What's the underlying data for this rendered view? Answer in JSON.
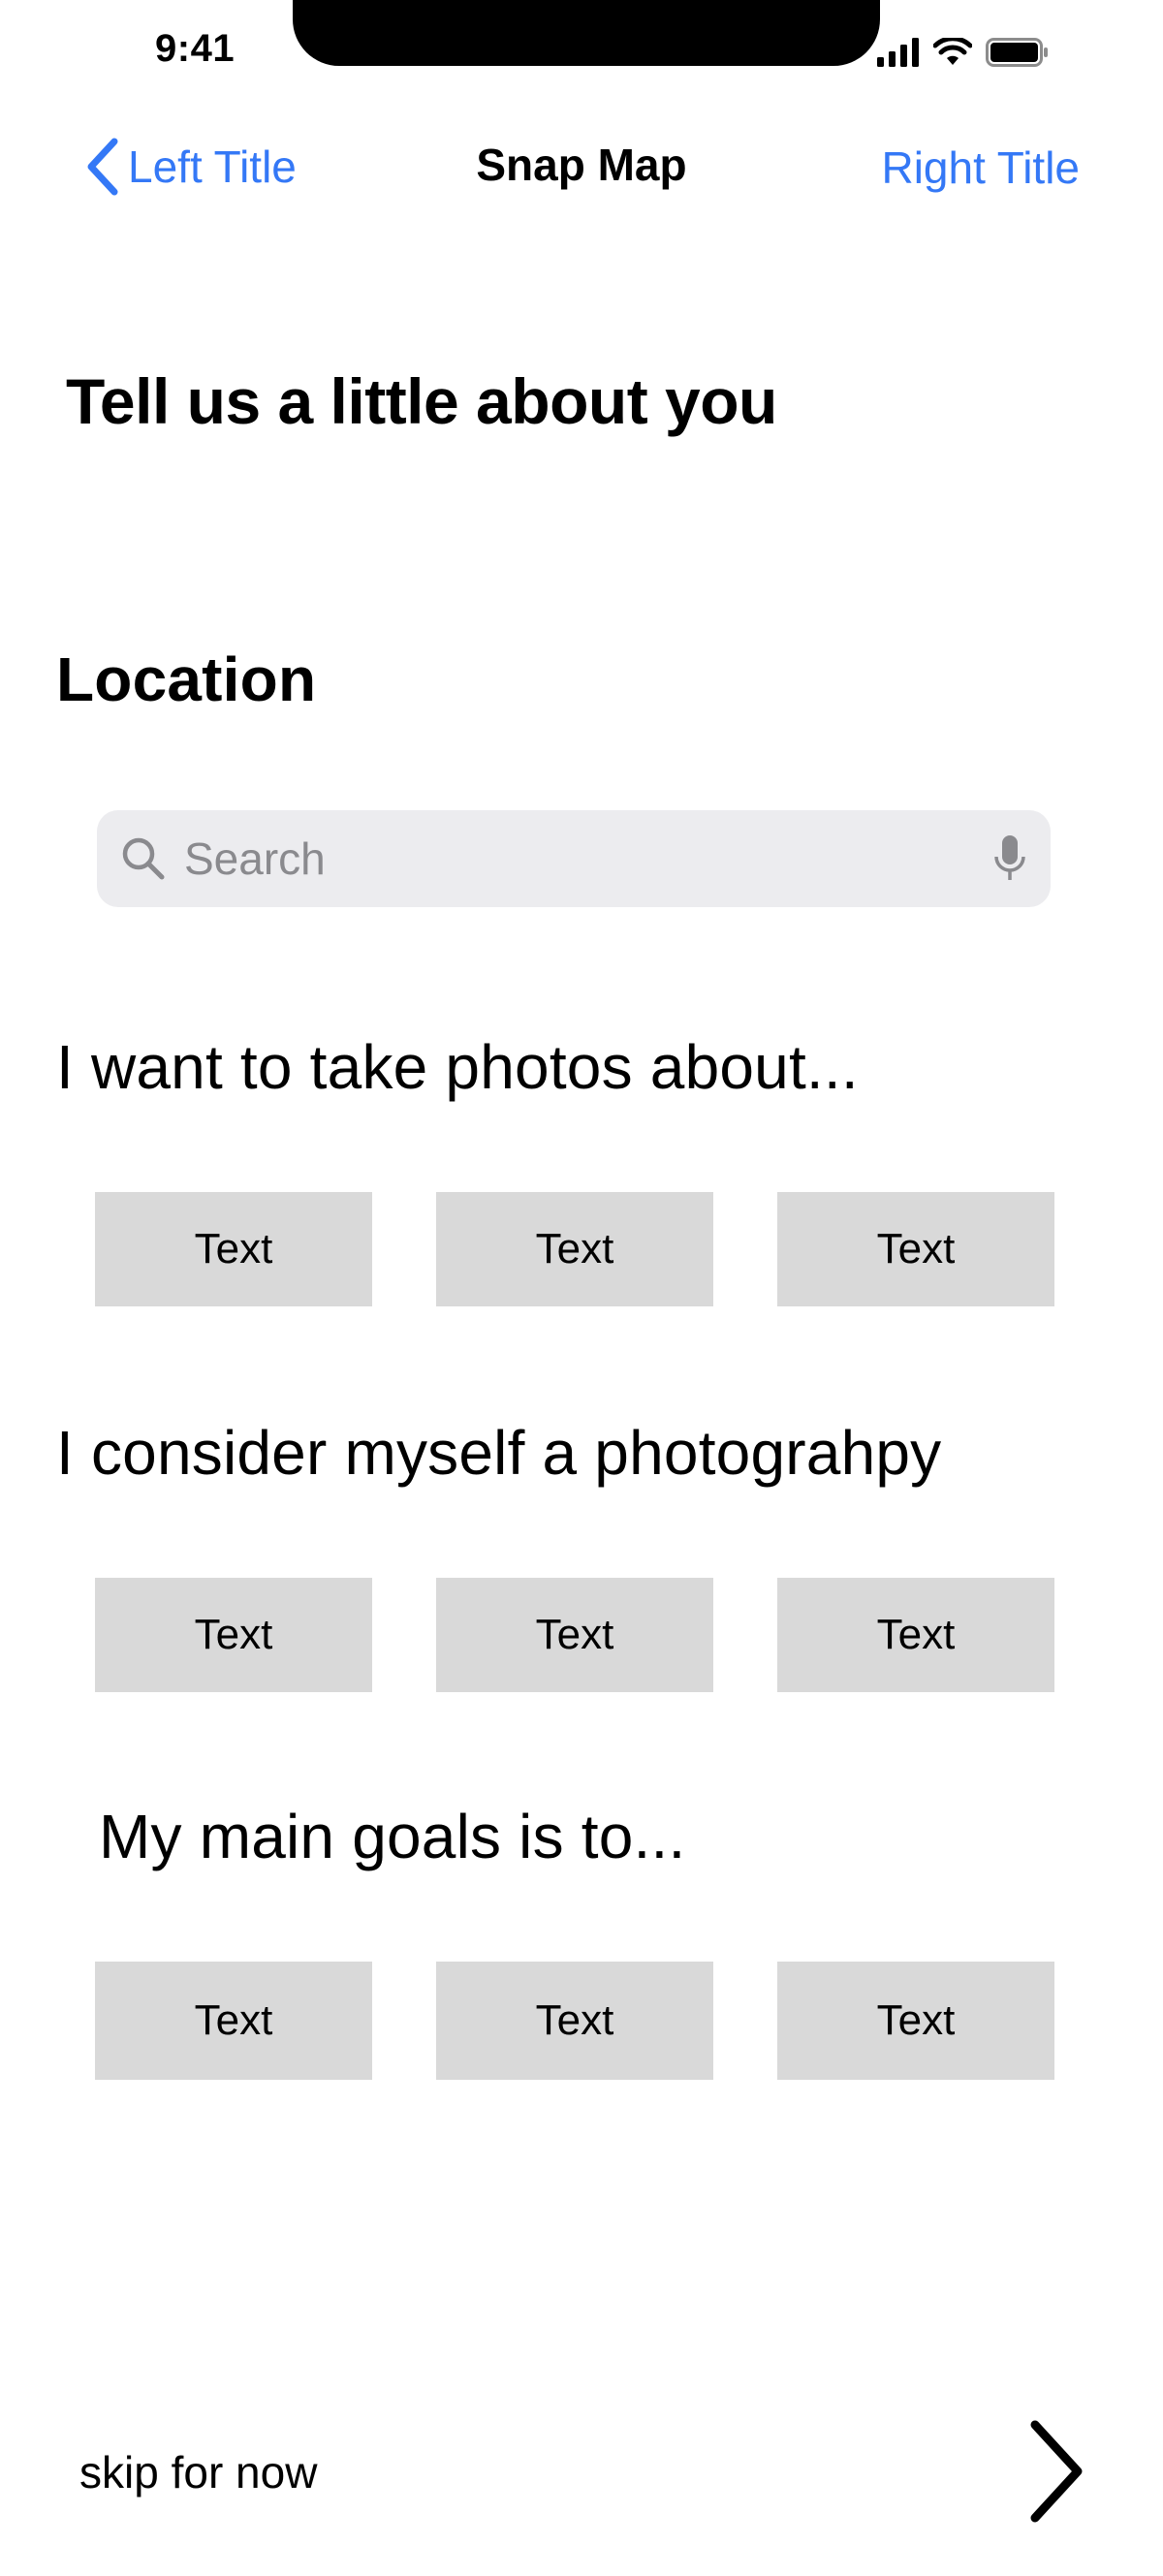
{
  "status_bar": {
    "time": "9:41",
    "icons": [
      "cellular-signal-icon",
      "wifi-icon",
      "battery-icon"
    ]
  },
  "nav": {
    "back_label": "Left Title",
    "title": "Snap Map",
    "right_label": "Right Title",
    "back_icon": "chevron-left-icon"
  },
  "page": {
    "title": "Tell us a little about you"
  },
  "location": {
    "heading": "Location",
    "search": {
      "placeholder": "Search",
      "value": "",
      "icons": [
        "search-icon",
        "microphone-icon"
      ]
    }
  },
  "photo_topics": {
    "heading": "I want to take photos about...",
    "options": [
      "Text",
      "Text",
      "Text"
    ]
  },
  "photography_level": {
    "heading": "I consider myself a photograhpy",
    "options": [
      "Text",
      "Text",
      "Text"
    ]
  },
  "goals": {
    "heading": "My main goals is to...",
    "options": [
      "Text",
      "Text",
      "Text"
    ]
  },
  "footer": {
    "skip_label": "skip for now",
    "next_icon": "chevron-right-icon"
  },
  "colors": {
    "accent": "#3478f6",
    "chip_background": "#d9d9d9",
    "search_background": "#ececef",
    "placeholder": "#8a8a8e"
  }
}
